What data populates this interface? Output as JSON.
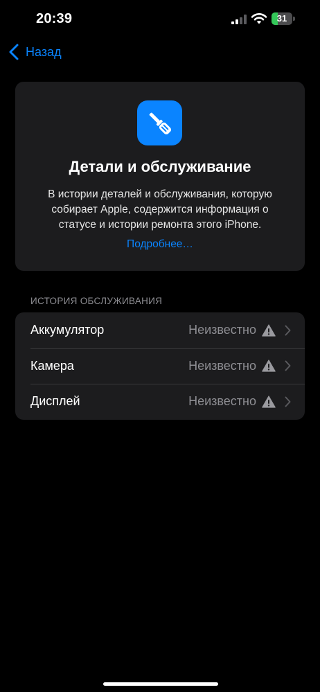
{
  "status_bar": {
    "time": "20:39",
    "battery_percent": "31",
    "battery_level": 0.31,
    "signal_bars": 2,
    "icons": [
      "cellular-signal-icon",
      "wifi-icon",
      "battery-charging-icon"
    ]
  },
  "nav": {
    "back_label": "Назад",
    "back_icon": "chevron-left-icon"
  },
  "card": {
    "icon": "screwdriver-icon",
    "title": "Детали и обслуживание",
    "description": "В истории деталей и обслуживания, которую собирает Apple, содержится информация о статусе и истории ремонта этого iPhone.",
    "link": "Подробнее…"
  },
  "history": {
    "header": "ИСТОРИЯ ОБСЛУЖИВАНИЯ",
    "rows": [
      {
        "label": "Аккумулятор",
        "value": "Неизвестно",
        "icon": "warning-icon"
      },
      {
        "label": "Камера",
        "value": "Неизвестно",
        "icon": "warning-icon"
      },
      {
        "label": "Дисплей",
        "value": "Неизвестно",
        "icon": "warning-icon"
      }
    ]
  },
  "colors": {
    "accent": "#0a84ff",
    "card_bg": "#1c1c1e",
    "battery_green": "#34c759",
    "secondary_text": "#8e8e93"
  }
}
